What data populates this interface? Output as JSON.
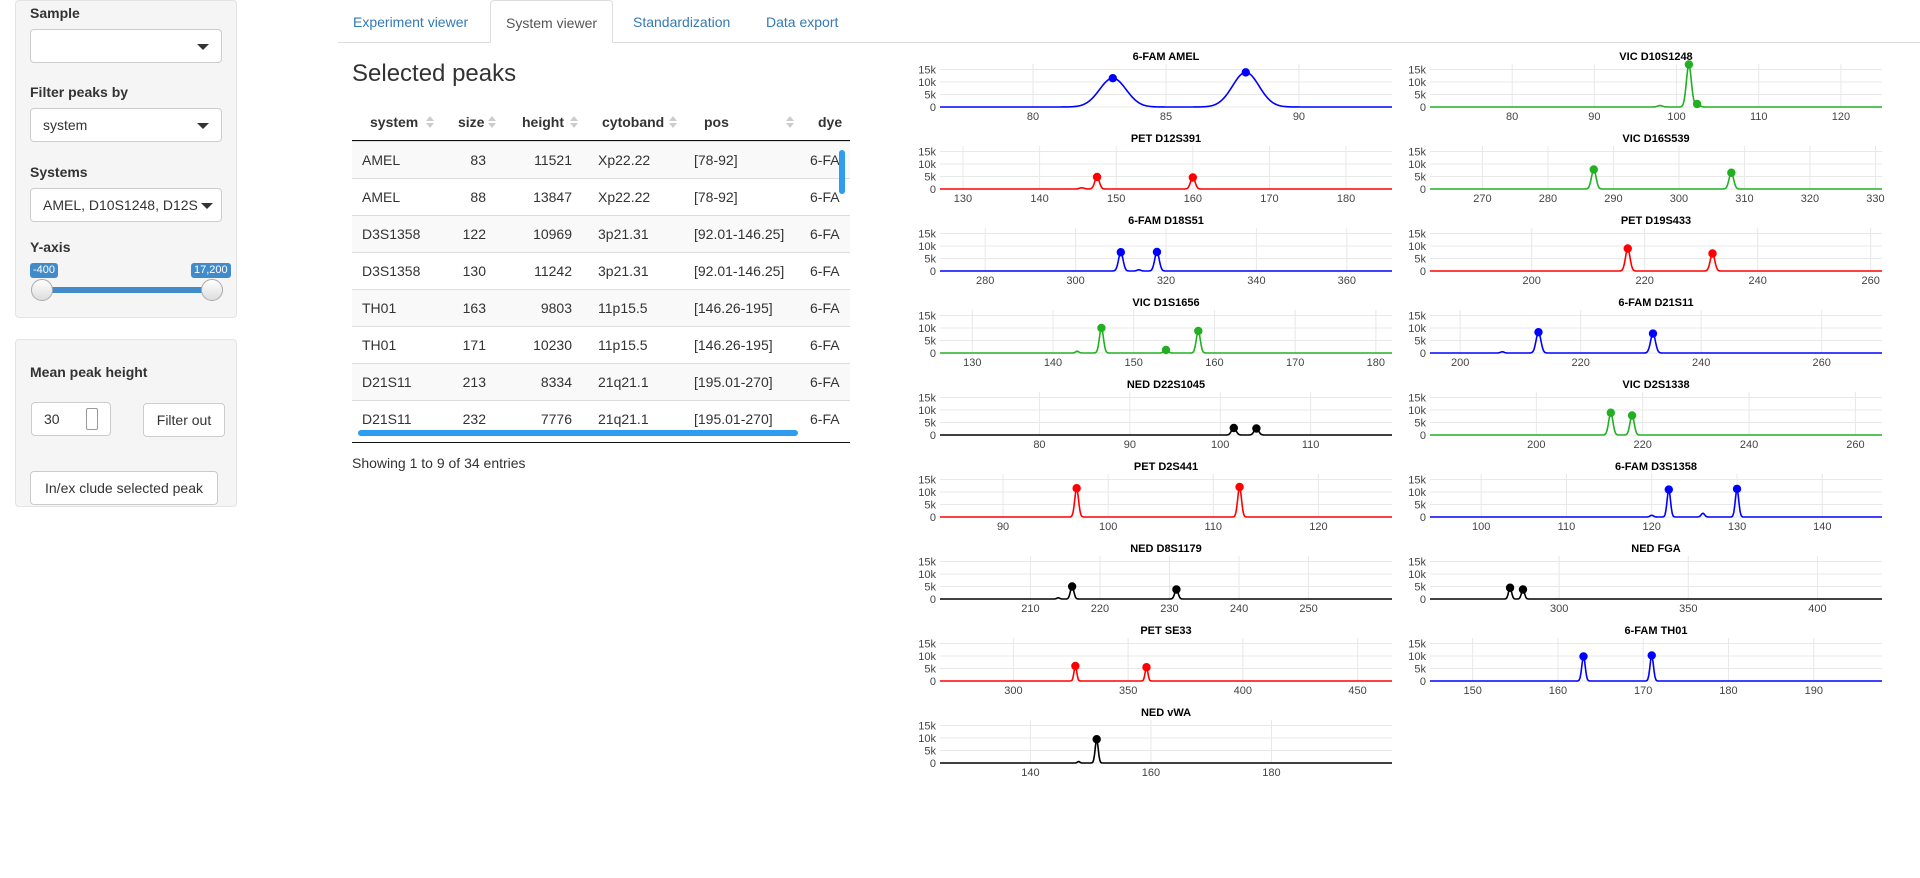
{
  "sidebar": {
    "sample_label": "Sample",
    "sample_value": "",
    "filter_label": "Filter peaks by",
    "filter_value": "system",
    "systems_label": "Systems",
    "systems_value": "AMEL, D10S1248, D12S",
    "yaxis_label": "Y-axis",
    "yaxis_min": "-400",
    "yaxis_max": "17,200",
    "yaxis_range": [
      -400,
      17200
    ],
    "mean_peak_label": "Mean peak height",
    "mean_peak_value": "30",
    "filter_out_button": "Filter out",
    "inex_button": "In/ex clude selected peak"
  },
  "tabs": [
    {
      "label": "Experiment viewer",
      "active": false
    },
    {
      "label": "System viewer",
      "active": true
    },
    {
      "label": "Standardization",
      "active": false
    },
    {
      "label": "Data export",
      "active": false
    }
  ],
  "table": {
    "title": "Selected peaks",
    "columns": [
      "system",
      "size",
      "height",
      "cytoband",
      "pos",
      "dye"
    ],
    "rows": [
      [
        "AMEL",
        "83",
        "11521",
        "Xp22.22",
        "[78-92]",
        "6-FA"
      ],
      [
        "AMEL",
        "88",
        "13847",
        "Xp22.22",
        "[78-92]",
        "6-FA"
      ],
      [
        "D3S1358",
        "122",
        "10969",
        "3p21.31",
        "[92.01-146.25]",
        "6-FA"
      ],
      [
        "D3S1358",
        "130",
        "11242",
        "3p21.31",
        "[92.01-146.25]",
        "6-FA"
      ],
      [
        "TH01",
        "163",
        "9803",
        "11p15.5",
        "[146.26-195]",
        "6-FA"
      ],
      [
        "TH01",
        "171",
        "10230",
        "11p15.5",
        "[146.26-195]",
        "6-FA"
      ],
      [
        "D21S11",
        "213",
        "8334",
        "21q21.1",
        "[195.01-270]",
        "6-FA"
      ],
      [
        "D21S11",
        "232",
        "7776",
        "21q21.1",
        "[195.01-270]",
        "6-FA"
      ]
    ],
    "info": "Showing 1 to 9 of 34 entries"
  },
  "chart_data": [
    {
      "type": "line",
      "title": "6-FAM AMEL",
      "color": "#0000ff",
      "xlim": [
        76.5,
        93.5
      ],
      "xticks": [
        80,
        85,
        90
      ],
      "ylim": [
        0,
        17200
      ],
      "yticks": [
        0,
        5000,
        10000,
        15000
      ],
      "yticklabels": [
        "0",
        "5k",
        "10k",
        "15k"
      ],
      "peaks": [
        {
          "x": 83,
          "y": 11521,
          "w": 0.5
        },
        {
          "x": 88,
          "y": 13847,
          "w": 0.5
        }
      ],
      "markers": [
        {
          "x": 83,
          "y": 11521
        },
        {
          "x": 88,
          "y": 13847
        }
      ]
    },
    {
      "type": "line",
      "title": "VIC D10S1248",
      "color": "#22b022",
      "xlim": [
        70,
        125
      ],
      "xticks": [
        80,
        90,
        100,
        110,
        120
      ],
      "ylim": [
        0,
        17200
      ],
      "yticks": [
        0,
        5000,
        10000,
        15000
      ],
      "yticklabels": [
        "0",
        "5k",
        "10k",
        "15k"
      ],
      "peaks": [
        {
          "x": 101.5,
          "y": 17000,
          "w": 0.3
        },
        {
          "x": 102.5,
          "y": 1200,
          "w": 0.3
        },
        {
          "x": 98,
          "y": 600,
          "w": 0.3
        }
      ],
      "markers": [
        {
          "x": 101.5,
          "y": 17000
        },
        {
          "x": 102.5,
          "y": 1200
        }
      ]
    },
    {
      "type": "line",
      "title": "PET D12S391",
      "color": "#ff0000",
      "xlim": [
        127,
        186
      ],
      "xticks": [
        130,
        140,
        150,
        160,
        170,
        180
      ],
      "ylim": [
        0,
        17200
      ],
      "yticks": [
        0,
        5000,
        10000,
        15000
      ],
      "yticklabels": [
        "0",
        "5k",
        "10k",
        "15k"
      ],
      "peaks": [
        {
          "x": 147.5,
          "y": 4800,
          "w": 0.3
        },
        {
          "x": 160,
          "y": 4600,
          "w": 0.3
        },
        {
          "x": 145.5,
          "y": 500,
          "w": 0.3
        }
      ],
      "markers": [
        {
          "x": 147.5,
          "y": 4800
        },
        {
          "x": 160,
          "y": 4600
        }
      ]
    },
    {
      "type": "line",
      "title": "VIC D16S539",
      "color": "#22b022",
      "xlim": [
        262,
        331
      ],
      "xticks": [
        270,
        280,
        290,
        300,
        310,
        320,
        330
      ],
      "ylim": [
        0,
        17200
      ],
      "yticks": [
        0,
        5000,
        10000,
        15000
      ],
      "yticklabels": [
        "0",
        "5k",
        "10k",
        "15k"
      ],
      "peaks": [
        {
          "x": 287,
          "y": 7800,
          "w": 0.35
        },
        {
          "x": 308,
          "y": 6500,
          "w": 0.35
        }
      ],
      "markers": [
        {
          "x": 287,
          "y": 7800
        },
        {
          "x": 308,
          "y": 6500
        }
      ]
    },
    {
      "type": "line",
      "title": "6-FAM D18S51",
      "color": "#0000ff",
      "xlim": [
        270,
        370
      ],
      "xticks": [
        280,
        300,
        320,
        340,
        360
      ],
      "ylim": [
        0,
        17200
      ],
      "yticks": [
        0,
        5000,
        10000,
        15000
      ],
      "yticklabels": [
        "0",
        "5k",
        "10k",
        "15k"
      ],
      "peaks": [
        {
          "x": 310,
          "y": 7500,
          "w": 0.5
        },
        {
          "x": 318,
          "y": 7600,
          "w": 0.5
        },
        {
          "x": 314,
          "y": 500,
          "w": 0.4
        }
      ],
      "markers": [
        {
          "x": 310,
          "y": 7500
        },
        {
          "x": 318,
          "y": 7600
        }
      ]
    },
    {
      "type": "line",
      "title": "PET D19S433",
      "color": "#ff0000",
      "xlim": [
        182,
        262
      ],
      "xticks": [
        200,
        220,
        240,
        260
      ],
      "ylim": [
        0,
        17200
      ],
      "yticks": [
        0,
        5000,
        10000,
        15000
      ],
      "yticklabels": [
        "0",
        "5k",
        "10k",
        "15k"
      ],
      "peaks": [
        {
          "x": 217,
          "y": 9000,
          "w": 0.4
        },
        {
          "x": 232,
          "y": 7000,
          "w": 0.4
        }
      ],
      "markers": [
        {
          "x": 217,
          "y": 9000
        },
        {
          "x": 232,
          "y": 7000
        }
      ]
    },
    {
      "type": "line",
      "title": "VIC D1S1656",
      "color": "#22b022",
      "xlim": [
        126,
        182
      ],
      "xticks": [
        130,
        140,
        150,
        160,
        170,
        180
      ],
      "ylim": [
        0,
        17200
      ],
      "yticks": [
        0,
        5000,
        10000,
        15000
      ],
      "yticklabels": [
        "0",
        "5k",
        "10k",
        "15k"
      ],
      "peaks": [
        {
          "x": 146,
          "y": 10000,
          "w": 0.25
        },
        {
          "x": 158,
          "y": 8800,
          "w": 0.25
        },
        {
          "x": 154,
          "y": 1200,
          "w": 0.25
        },
        {
          "x": 143,
          "y": 700,
          "w": 0.2
        }
      ],
      "markers": [
        {
          "x": 146,
          "y": 10000
        },
        {
          "x": 158,
          "y": 8800
        },
        {
          "x": 154,
          "y": 1200
        }
      ]
    },
    {
      "type": "line",
      "title": "6-FAM D21S11",
      "color": "#0000ff",
      "xlim": [
        195,
        270
      ],
      "xticks": [
        200,
        220,
        240,
        260
      ],
      "ylim": [
        0,
        17200
      ],
      "yticks": [
        0,
        5000,
        10000,
        15000
      ],
      "yticklabels": [
        "0",
        "5k",
        "10k",
        "15k"
      ],
      "peaks": [
        {
          "x": 213,
          "y": 8334,
          "w": 0.4
        },
        {
          "x": 232,
          "y": 7776,
          "w": 0.4
        },
        {
          "x": 207,
          "y": 500,
          "w": 0.3
        }
      ],
      "markers": [
        {
          "x": 213,
          "y": 8334
        },
        {
          "x": 232,
          "y": 7776
        }
      ]
    },
    {
      "type": "line",
      "title": "NED D22S1045",
      "color": "#000000",
      "xlim": [
        69,
        119
      ],
      "xticks": [
        80,
        90,
        100,
        110
      ],
      "ylim": [
        0,
        17200
      ],
      "yticks": [
        0,
        5000,
        10000,
        15000
      ],
      "yticklabels": [
        "0",
        "5k",
        "10k",
        "15k"
      ],
      "peaks": [
        {
          "x": 101.5,
          "y": 2800,
          "w": 0.25
        },
        {
          "x": 104,
          "y": 2600,
          "w": 0.25
        }
      ],
      "markers": [
        {
          "x": 101.5,
          "y": 2800
        },
        {
          "x": 104,
          "y": 2600
        }
      ]
    },
    {
      "type": "line",
      "title": "VIC D2S1338",
      "color": "#22b022",
      "xlim": [
        180,
        265
      ],
      "xticks": [
        200,
        220,
        240,
        260
      ],
      "ylim": [
        0,
        17200
      ],
      "yticks": [
        0,
        5000,
        10000,
        15000
      ],
      "yticklabels": [
        "0",
        "5k",
        "10k",
        "15k"
      ],
      "peaks": [
        {
          "x": 214,
          "y": 8900,
          "w": 0.4
        },
        {
          "x": 218,
          "y": 7800,
          "w": 0.4
        }
      ],
      "markers": [
        {
          "x": 214,
          "y": 8900
        },
        {
          "x": 218,
          "y": 7800
        }
      ]
    },
    {
      "type": "line",
      "title": "PET D2S441",
      "color": "#ff0000",
      "xlim": [
        84,
        127
      ],
      "xticks": [
        90,
        100,
        110,
        120
      ],
      "ylim": [
        0,
        17200
      ],
      "yticks": [
        0,
        5000,
        10000,
        15000
      ],
      "yticklabels": [
        "0",
        "5k",
        "10k",
        "15k"
      ],
      "peaks": [
        {
          "x": 97,
          "y": 11500,
          "w": 0.18
        },
        {
          "x": 112.5,
          "y": 12000,
          "w": 0.18
        }
      ],
      "markers": [
        {
          "x": 97,
          "y": 11500
        },
        {
          "x": 112.5,
          "y": 12000
        }
      ]
    },
    {
      "type": "line",
      "title": "6-FAM D3S1358",
      "color": "#0000ff",
      "xlim": [
        94,
        147
      ],
      "xticks": [
        100,
        110,
        120,
        130,
        140
      ],
      "ylim": [
        0,
        17200
      ],
      "yticks": [
        0,
        5000,
        10000,
        15000
      ],
      "yticklabels": [
        "0",
        "5k",
        "10k",
        "15k"
      ],
      "peaks": [
        {
          "x": 122,
          "y": 10969,
          "w": 0.2
        },
        {
          "x": 130,
          "y": 11242,
          "w": 0.2
        },
        {
          "x": 126,
          "y": 1500,
          "w": 0.2
        },
        {
          "x": 120,
          "y": 700,
          "w": 0.2
        }
      ],
      "markers": [
        {
          "x": 122,
          "y": 10969
        },
        {
          "x": 130,
          "y": 11242
        }
      ]
    },
    {
      "type": "line",
      "title": "NED D8S1179",
      "color": "#000000",
      "xlim": [
        197,
        262
      ],
      "xticks": [
        210,
        220,
        230,
        240,
        250
      ],
      "ylim": [
        0,
        17200
      ],
      "yticks": [
        0,
        5000,
        10000,
        15000
      ],
      "yticklabels": [
        "0",
        "5k",
        "10k",
        "15k"
      ],
      "peaks": [
        {
          "x": 216,
          "y": 5000,
          "w": 0.25
        },
        {
          "x": 231,
          "y": 3800,
          "w": 0.25
        },
        {
          "x": 214,
          "y": 500,
          "w": 0.2
        }
      ],
      "markers": [
        {
          "x": 216,
          "y": 5000
        },
        {
          "x": 231,
          "y": 3800
        }
      ]
    },
    {
      "type": "line",
      "title": "NED FGA",
      "color": "#000000",
      "xlim": [
        250,
        425
      ],
      "xticks": [
        300,
        350,
        400
      ],
      "ylim": [
        0,
        17200
      ],
      "yticks": [
        0,
        5000,
        10000,
        15000
      ],
      "yticklabels": [
        "0",
        "5k",
        "10k",
        "15k"
      ],
      "peaks": [
        {
          "x": 281,
          "y": 4500,
          "w": 0.6
        },
        {
          "x": 286,
          "y": 3800,
          "w": 0.6
        }
      ],
      "markers": [
        {
          "x": 281,
          "y": 4500
        },
        {
          "x": 286,
          "y": 3800
        }
      ]
    },
    {
      "type": "line",
      "title": "PET SE33",
      "color": "#ff0000",
      "xlim": [
        268,
        465
      ],
      "xticks": [
        300,
        350,
        400,
        450
      ],
      "ylim": [
        0,
        17200
      ],
      "yticks": [
        0,
        5000,
        10000,
        15000
      ],
      "yticklabels": [
        "0",
        "5k",
        "10k",
        "15k"
      ],
      "peaks": [
        {
          "x": 327,
          "y": 6000,
          "w": 0.6
        },
        {
          "x": 358,
          "y": 5500,
          "w": 0.6
        }
      ],
      "markers": [
        {
          "x": 327,
          "y": 6000
        },
        {
          "x": 358,
          "y": 5500
        }
      ]
    },
    {
      "type": "line",
      "title": "6-FAM TH01",
      "color": "#0000ff",
      "xlim": [
        145,
        198
      ],
      "xticks": [
        150,
        160,
        170,
        180,
        190
      ],
      "ylim": [
        0,
        17200
      ],
      "yticks": [
        0,
        5000,
        10000,
        15000
      ],
      "yticklabels": [
        "0",
        "5k",
        "10k",
        "15k"
      ],
      "peaks": [
        {
          "x": 163,
          "y": 9803,
          "w": 0.2
        },
        {
          "x": 171,
          "y": 10230,
          "w": 0.2
        }
      ],
      "markers": [
        {
          "x": 163,
          "y": 9803
        },
        {
          "x": 171,
          "y": 10230
        }
      ]
    },
    {
      "type": "line",
      "title": "NED vWA",
      "color": "#000000",
      "xlim": [
        125,
        200
      ],
      "xticks": [
        140,
        160,
        180
      ],
      "ylim": [
        0,
        17200
      ],
      "yticks": [
        0,
        5000,
        10000,
        15000
      ],
      "yticklabels": [
        "0",
        "5k",
        "10k",
        "15k"
      ],
      "peaks": [
        {
          "x": 151,
          "y": 9500,
          "w": 0.25
        },
        {
          "x": 148,
          "y": 600,
          "w": 0.2
        }
      ],
      "markers": [
        {
          "x": 151,
          "y": 9500
        }
      ]
    }
  ]
}
